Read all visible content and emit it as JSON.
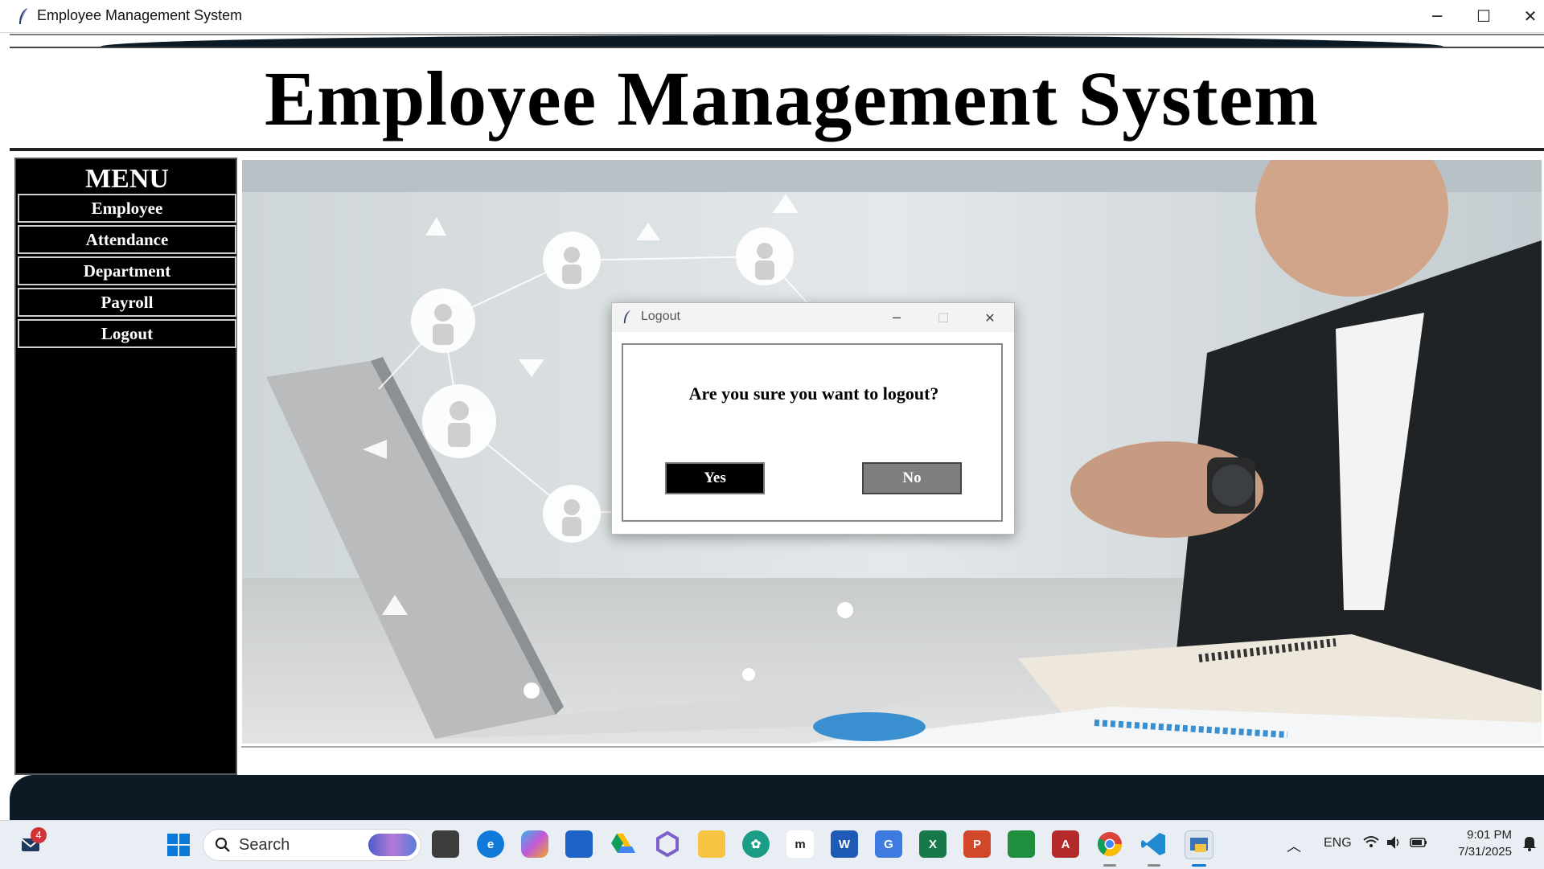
{
  "window": {
    "title": "Employee Management System",
    "minimize_glyph": "─",
    "maximize_glyph": "☐",
    "close_glyph": "✕"
  },
  "header": {
    "title": "Employee Management System"
  },
  "menu": {
    "title": "MENU",
    "items": [
      {
        "label": "Employee"
      },
      {
        "label": "Attendance"
      },
      {
        "label": "Department"
      },
      {
        "label": "Payroll"
      },
      {
        "label": "Logout"
      }
    ]
  },
  "main": {
    "image": "office-network-photo"
  },
  "dialog": {
    "title": "Logout",
    "question": "Are you sure you want to logout?",
    "yes_label": "Yes",
    "no_label": "No",
    "minimize_glyph": "─",
    "maximize_glyph": "☐",
    "close_glyph": "✕"
  },
  "taskbar": {
    "search_placeholder": "Search",
    "notification_count": "4",
    "language": "ENG",
    "time": "9:01 PM",
    "date": "7/31/2025",
    "apps": [
      "file-explorer-dark",
      "edge",
      "copilot",
      "store",
      "google-drive",
      "office-hub",
      "file-explorer",
      "chatgpt",
      "app-m",
      "word",
      "translate",
      "excel",
      "powerpoint",
      "classroom",
      "access",
      "chrome",
      "vscode",
      "python"
    ]
  },
  "colors": {
    "menu_bg": "#000000",
    "dialog_yes_bg": "#000000",
    "dialog_no_bg": "#7e7e7e",
    "banner_dark": "#0b1a24"
  }
}
